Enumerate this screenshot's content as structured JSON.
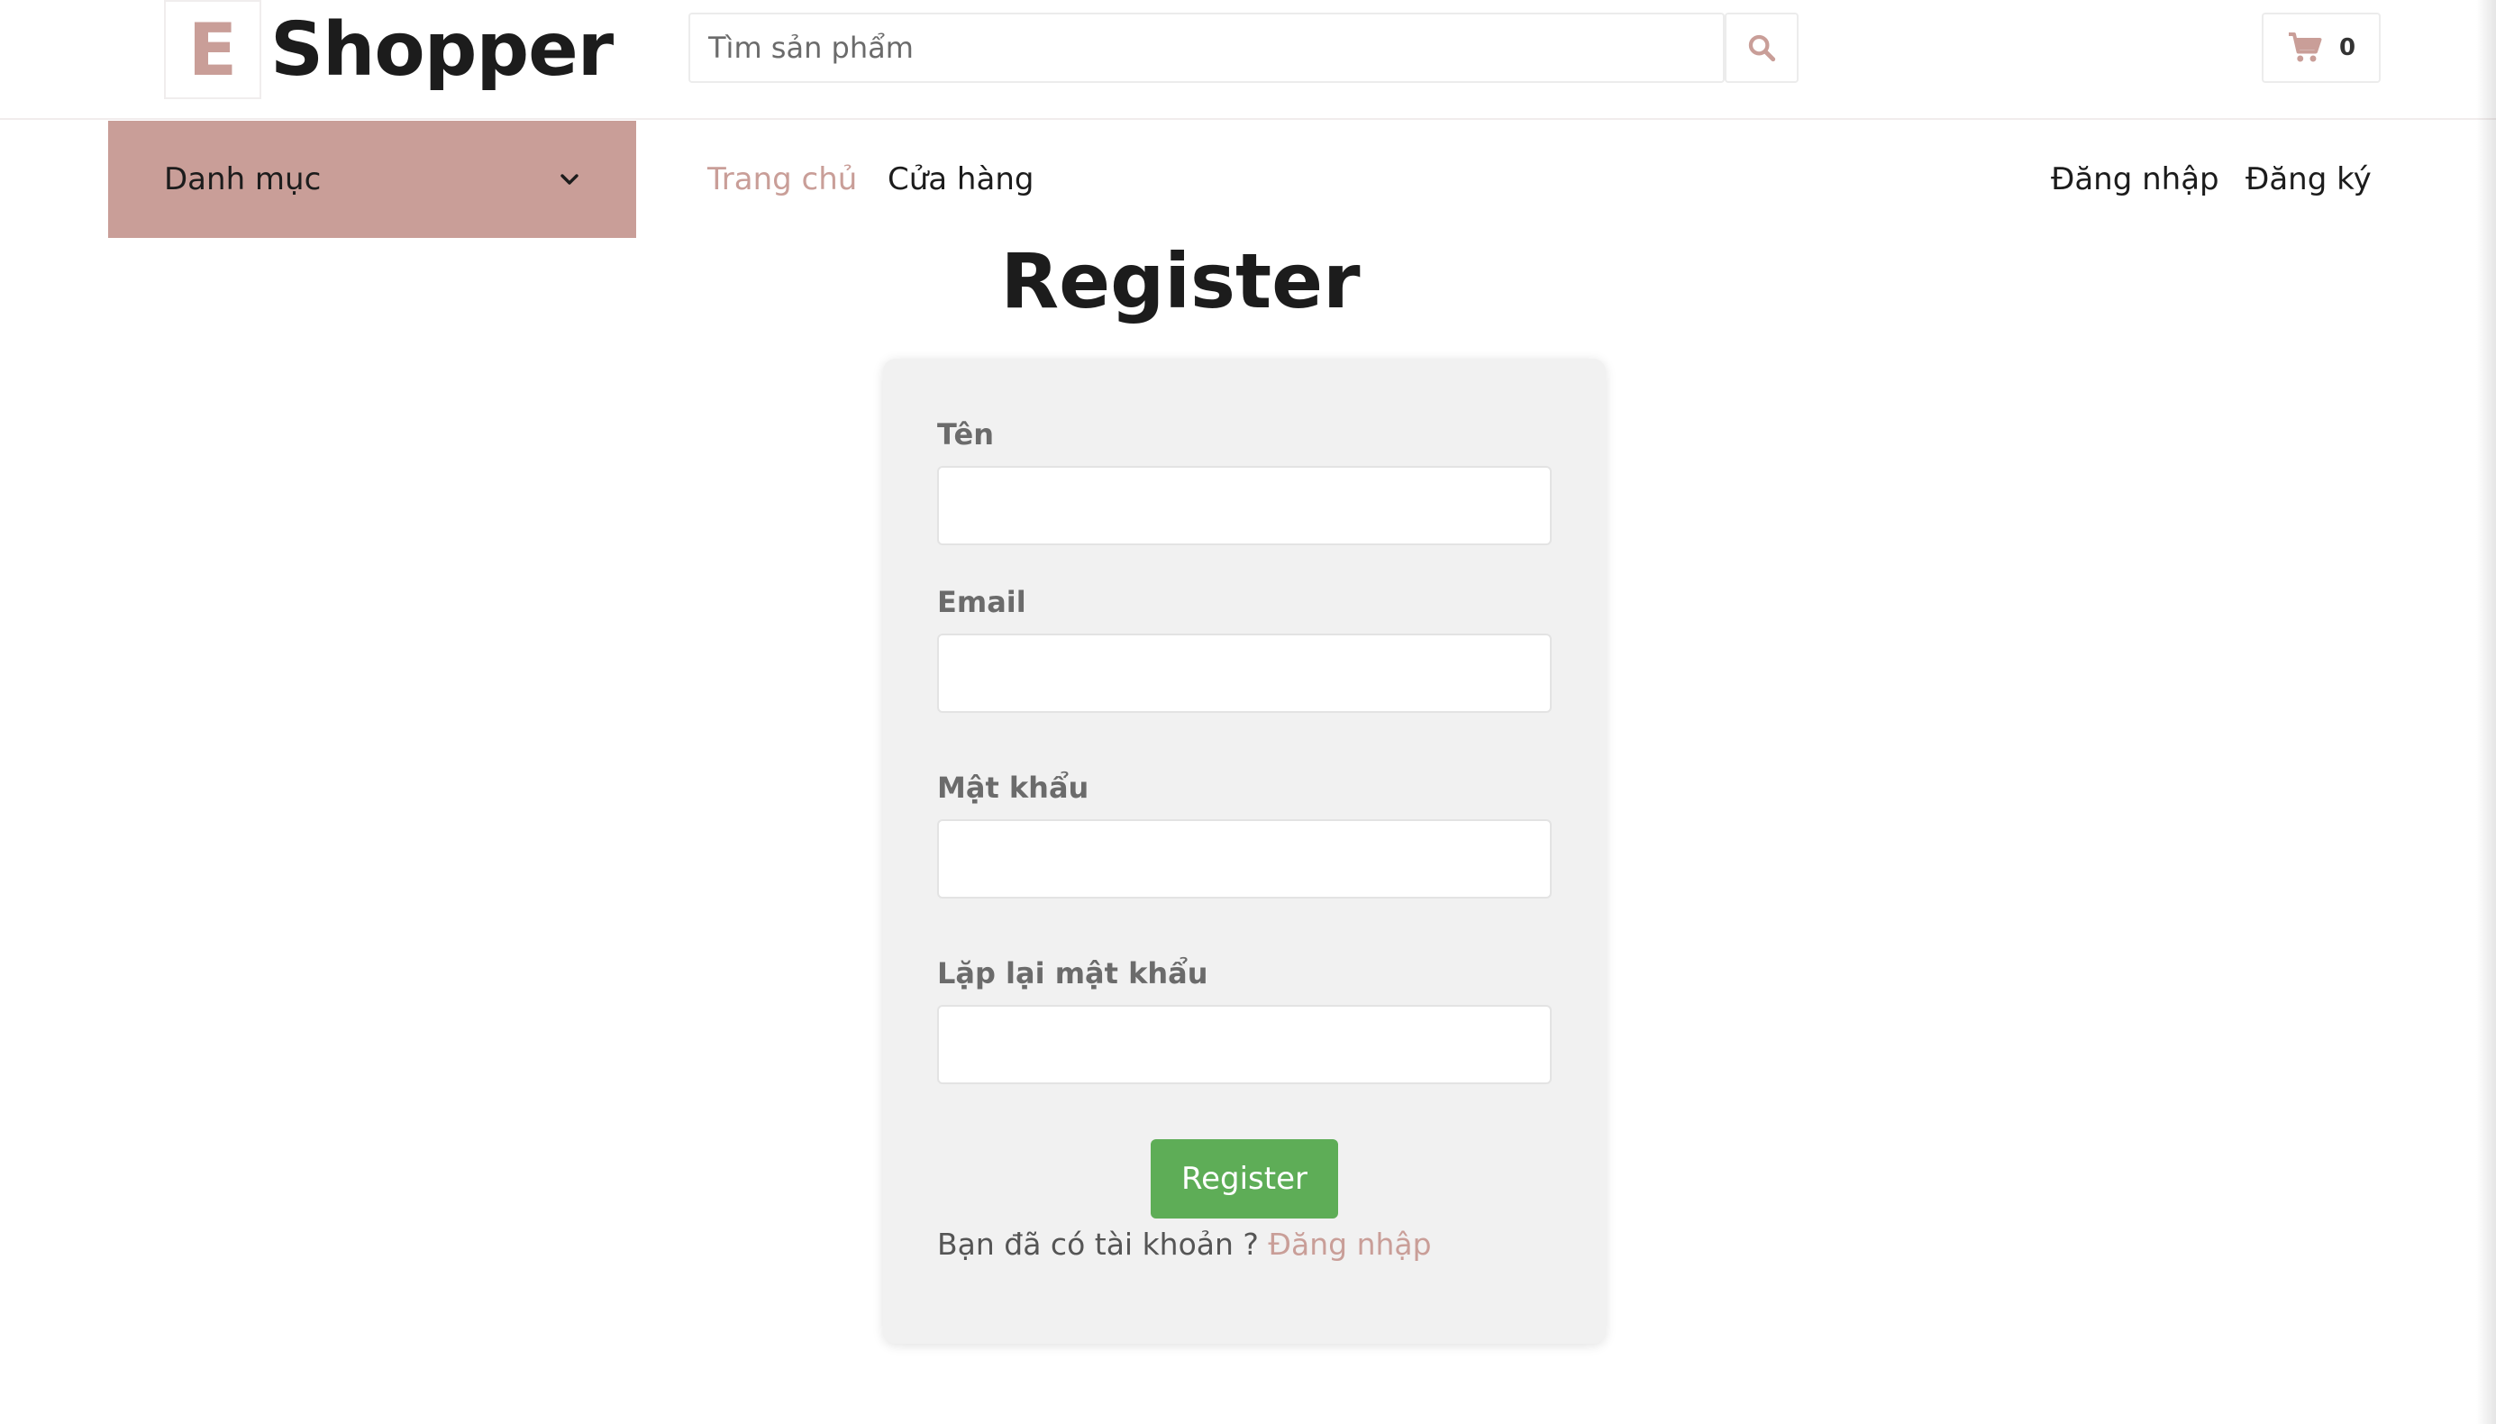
{
  "header": {
    "logo_letter": "E",
    "logo_text": "Shopper",
    "search_placeholder": "Tìm sản phẩm",
    "search_icon": "search-icon",
    "cart_icon": "cart-icon",
    "cart_count": "0"
  },
  "navbar": {
    "categories_label": "Danh mục",
    "categories_icon": "chevron-down-icon",
    "links": [
      {
        "label": "Trang chủ",
        "active": true
      },
      {
        "label": "Cửa hàng",
        "active": false
      }
    ],
    "auth_links": [
      {
        "label": "Đăng nhập"
      },
      {
        "label": "Đăng ký"
      }
    ]
  },
  "page": {
    "title": "Register"
  },
  "form": {
    "fields": [
      {
        "label": "Tên",
        "value": ""
      },
      {
        "label": "Email",
        "value": ""
      },
      {
        "label": "Mật khẩu",
        "value": ""
      },
      {
        "label": "Lặp lại mật khẩu",
        "value": ""
      }
    ],
    "submit_label": "Register",
    "have_account_text": "Bạn đã có tài khoản ? ",
    "login_link_label": "Đăng nhập"
  },
  "colors": {
    "accent": "#c99e98",
    "submit_button": "#5ead57",
    "card_background": "#f1f1f1",
    "text_dark": "#1c1c1c"
  }
}
